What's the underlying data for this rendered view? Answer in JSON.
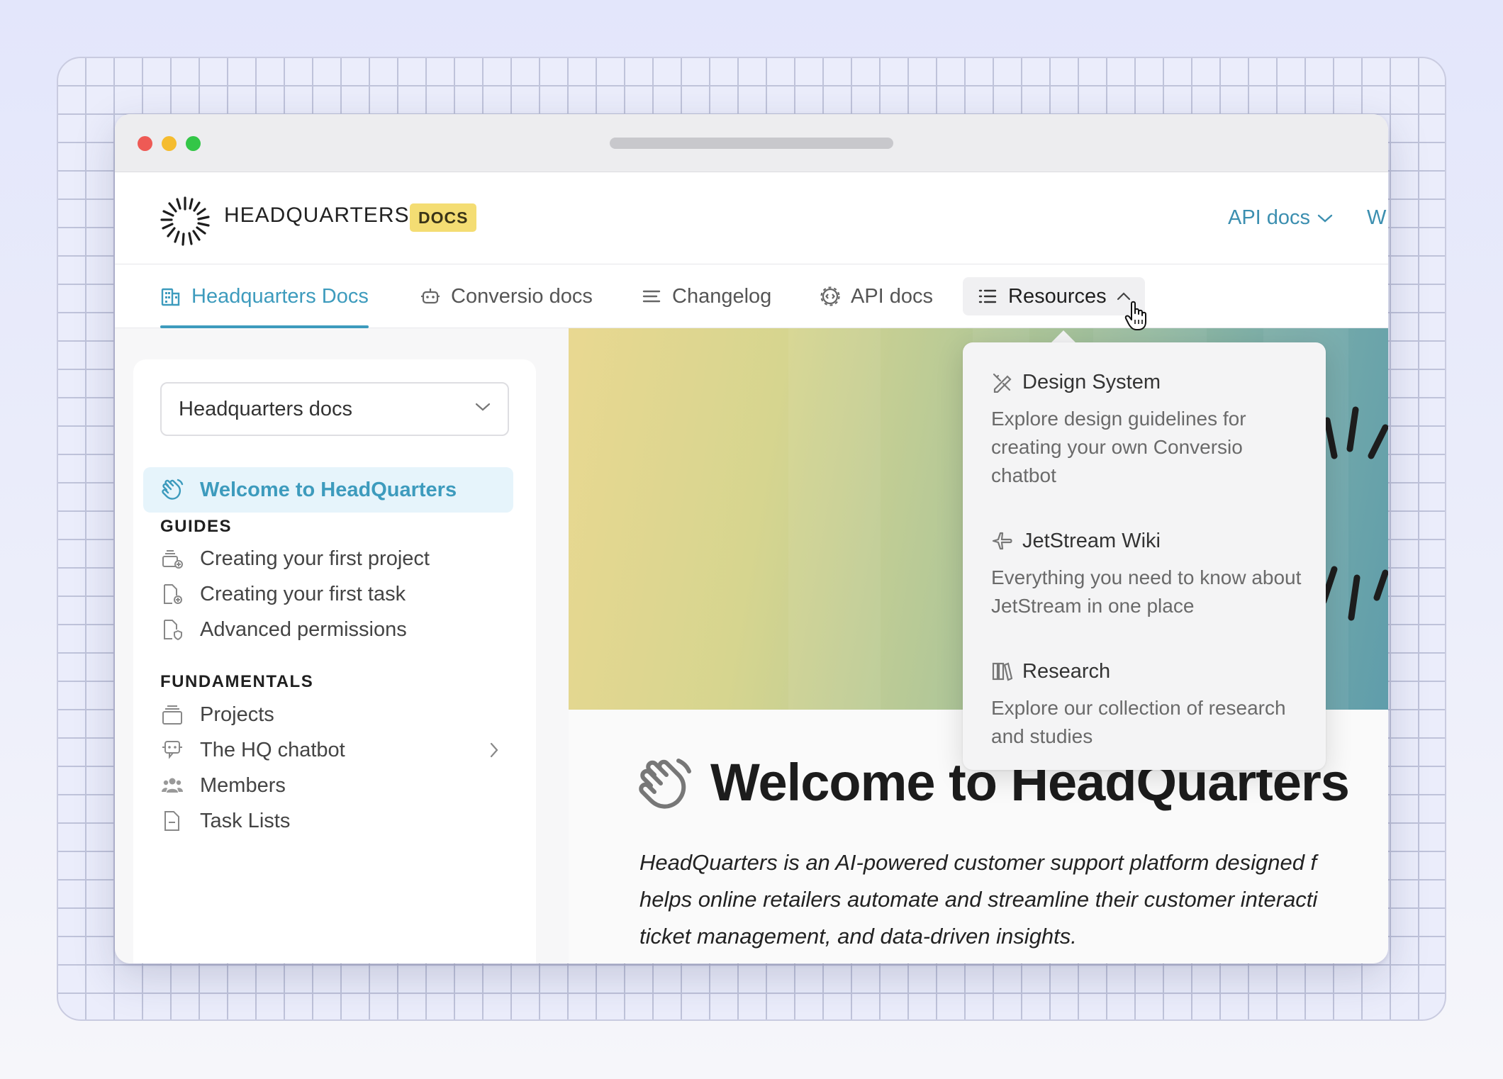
{
  "brand": {
    "name": "HEADQUARTERS",
    "badge": "DOCS",
    "logo_icon": "sunburst-logo-icon"
  },
  "header": {
    "links": [
      {
        "label": "API docs",
        "icon": "chevron-down-icon"
      },
      {
        "label": "W"
      }
    ]
  },
  "tabs": [
    {
      "label": "Headquarters Docs",
      "icon": "building-icon",
      "active": true
    },
    {
      "label": "Conversio docs",
      "icon": "robot-icon"
    },
    {
      "label": "Changelog",
      "icon": "lines-icon"
    },
    {
      "label": "API docs",
      "icon": "gear-code-icon"
    },
    {
      "label": "Resources",
      "icon": "list-icon",
      "open": true
    }
  ],
  "sidebar": {
    "select_value": "Headquarters docs",
    "active_item": {
      "label": "Welcome to HeadQuarters",
      "icon": "waving-hand-icon"
    },
    "sections": [
      {
        "title": "GUIDES",
        "items": [
          {
            "label": "Creating your first project",
            "icon": "stack-add-icon"
          },
          {
            "label": "Creating your first task",
            "icon": "file-add-icon"
          },
          {
            "label": "Advanced permissions",
            "icon": "file-shield-icon"
          }
        ]
      },
      {
        "title": "FUNDAMENTALS",
        "items": [
          {
            "label": "Projects",
            "icon": "stack-icon"
          },
          {
            "label": "The HQ chatbot",
            "icon": "chatbot-icon",
            "has_children": true
          },
          {
            "label": "Members",
            "icon": "users-icon"
          },
          {
            "label": "Task Lists",
            "icon": "file-icon"
          }
        ]
      }
    ]
  },
  "main": {
    "title": "Welcome to HeadQuarters",
    "intro_lines": [
      "HeadQuarters is an AI-powered customer support platform designed f",
      "helps online retailers automate and streamline their customer interacti",
      "ticket management, and data-driven insights."
    ]
  },
  "resources_menu": {
    "items": [
      {
        "title": "Design System",
        "icon": "design-tools-icon",
        "description": "Explore design guidelines for creating your own Conversio chatbot"
      },
      {
        "title": "JetStream Wiki",
        "icon": "plane-icon",
        "description": "Everything you need to know about JetStream in one place"
      },
      {
        "title": "Research",
        "icon": "books-icon",
        "description": "Explore our collection of research and studies"
      }
    ]
  },
  "colors": {
    "accent": "#3d9bbd",
    "badge": "#f4dd73",
    "active_bg": "#e6f4fb"
  }
}
